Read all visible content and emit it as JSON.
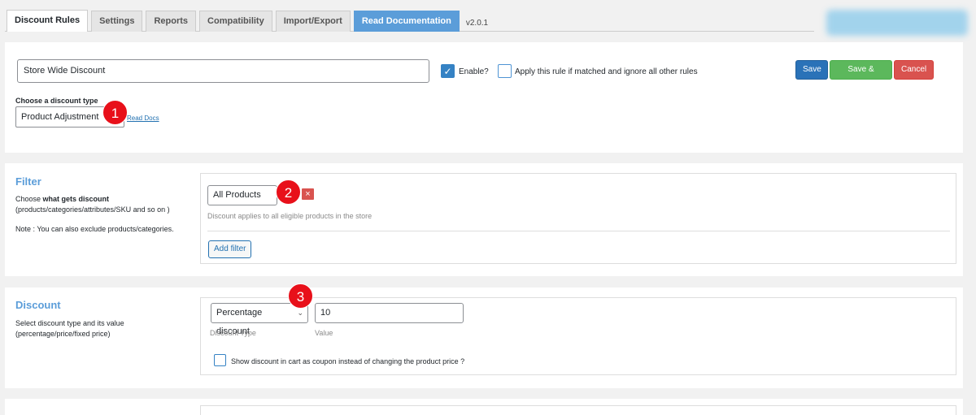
{
  "tabs": [
    {
      "label": "Discount Rules"
    },
    {
      "label": "Settings"
    },
    {
      "label": "Reports"
    },
    {
      "label": "Compatibility"
    },
    {
      "label": "Import/Export"
    },
    {
      "label": "Read Documentation"
    }
  ],
  "version": "v2.0.1",
  "rule": {
    "name_value": "Store Wide Discount",
    "enable_label": "Enable?",
    "enable_checked": true,
    "apply_label": "Apply this rule if matched and ignore all other rules",
    "apply_checked": false,
    "type_label": "Choose a discount type",
    "type_value": "Product Adjustment",
    "read_docs": "Read Docs"
  },
  "actions": {
    "save": "Save",
    "save_close": "Save & Close",
    "cancel": "Cancel"
  },
  "badges": {
    "one": "1",
    "two": "2",
    "three": "3"
  },
  "filter": {
    "title": "Filter",
    "desc_prefix": "Choose ",
    "desc_bold": "what gets discount",
    "desc_rest": "(products/categories/attributes/SKU and so on )",
    "note": "Note : You can also exclude products/categories.",
    "value": "All Products",
    "remove_icon": "×",
    "hint": "Discount applies to all eligible products in the store",
    "add_filter": "Add filter"
  },
  "discount": {
    "title": "Discount",
    "desc": "Select discount type and its value (percentage/price/fixed price)",
    "type_value": "Percentage discount",
    "type_hint": "Discount Type",
    "value": "10",
    "value_hint": "Value",
    "coupon_label": "Show discount in cart as coupon instead of changing the product price ?"
  },
  "colors": {
    "accent": "#5b9dd9",
    "save": "#2a72b8",
    "save_close": "#5cb85c",
    "cancel": "#d9534f",
    "badge": "#e8101a"
  }
}
